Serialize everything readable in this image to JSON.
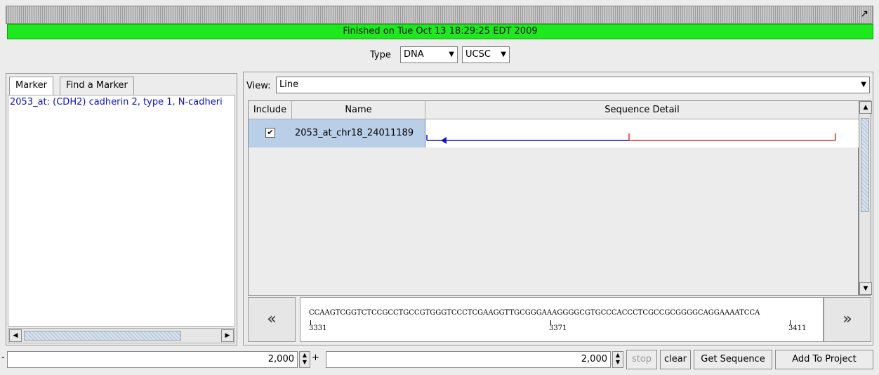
{
  "status": {
    "text": "Finished on Tue Oct 13 18:29:25 EDT 2009",
    "color": "#1ee81e"
  },
  "type_row": {
    "label": "Type",
    "type_value": "DNA",
    "source_value": "UCSC"
  },
  "left_panel": {
    "tabs": [
      "Marker",
      "Find a Marker"
    ],
    "markers": [
      "2053_at: (CDH2) cadherin 2, type 1, N-cadheri"
    ]
  },
  "right_panel": {
    "view_label": "View:",
    "view_value": "Line",
    "table": {
      "headers": [
        "Include",
        "Name",
        "Sequence Detail"
      ],
      "rows": [
        {
          "include": true,
          "name": "2053_at_chr18_24011189"
        }
      ]
    },
    "sequence": {
      "bases": "CCAAGTCGGTCTCCGCCTGCCGTGGGTCCCTCGAAGGTTGCGGGAAAGGGGCGTGCCCACCCTCGCCGCGGGGCAGGAAAATCCA",
      "positions": [
        "3331",
        "3371",
        "3411"
      ]
    },
    "nav": {
      "prev": "«",
      "next": "»"
    }
  },
  "bottom_bar": {
    "minus": "-",
    "plus": "+",
    "left_value": "2,000",
    "right_value": "2,000",
    "stop_label": "stop",
    "clear_label": "clear",
    "get_sequence_label": "Get Sequence",
    "add_project_label": "Add To Project"
  },
  "colors": {
    "selection": "#b9cfe8",
    "line_blue": "#1010d0",
    "line_red": "#e03030",
    "marker_text": "#1010c8"
  },
  "icons": {
    "expand": "expand-arrow-icon",
    "dropdown": "triangle-down-icon"
  }
}
